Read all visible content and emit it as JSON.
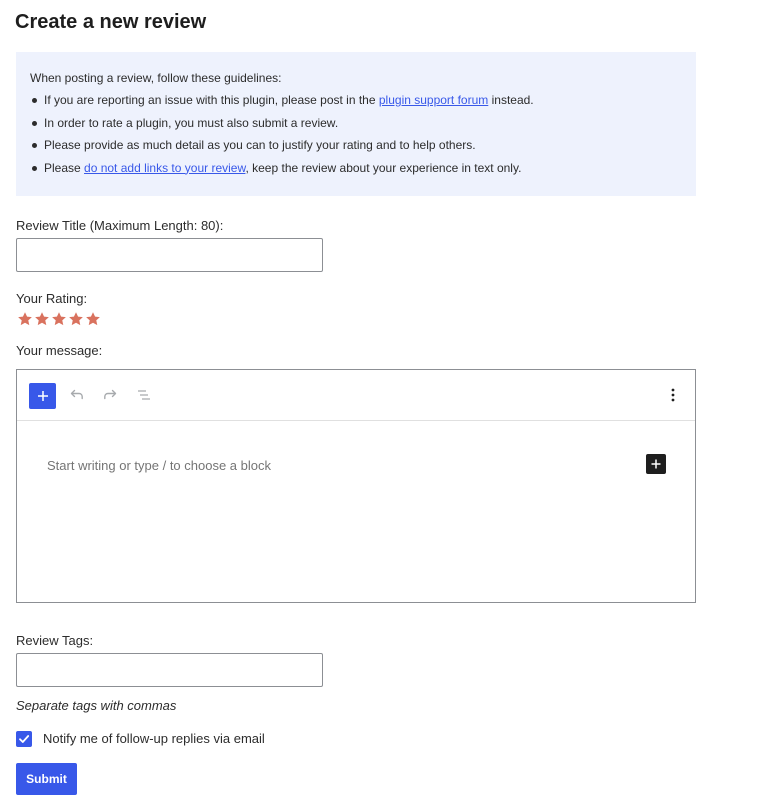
{
  "page_title": "Create a new review",
  "guidelines": {
    "intro": "When posting a review, follow these guidelines:",
    "item1_before": "If you are reporting an issue with this plugin, please post in the ",
    "item1_link": "plugin support forum",
    "item1_after": " instead.",
    "item2": "In order to rate a plugin, you must also submit a review.",
    "item3": "Please provide as much detail as you can to justify your rating and to help others.",
    "item4_before": "Please ",
    "item4_link": "do not add links to your review",
    "item4_after": ", keep the review about your experience in text only."
  },
  "review_title": {
    "label": "Review Title (Maximum Length: 80):",
    "value": ""
  },
  "rating": {
    "label": "Your Rating:",
    "value": 5,
    "max": 5,
    "star_color": "#d9725e"
  },
  "message": {
    "label": "Your message:",
    "placeholder": "Start writing or type / to choose a block",
    "toolbar_icons": [
      "plus-icon",
      "undo-icon",
      "redo-icon",
      "list-view-icon",
      "more-options-icon"
    ]
  },
  "tags": {
    "label": "Review Tags:",
    "value": "",
    "hint": "Separate tags with commas"
  },
  "notify": {
    "label": "Notify me of follow-up replies via email",
    "checked": true
  },
  "submit_label": "Submit",
  "colors": {
    "accent": "#3858e9",
    "guideline_bg": "#eef2fd"
  }
}
